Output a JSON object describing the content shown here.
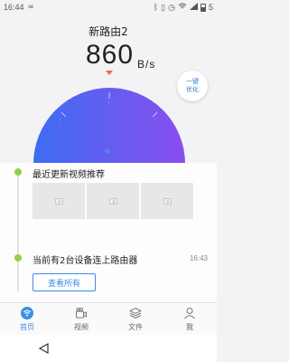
{
  "status_bar": {
    "time": "16:44",
    "battery_level": "5"
  },
  "header": {
    "title": "新路由2",
    "speed_value": "860",
    "speed_unit": "B/s"
  },
  "optimize_button": {
    "line1": "一键",
    "line2": "优化"
  },
  "gauge": {
    "gradient_start": "#3d6df2",
    "gradient_end": "#8a4ef0"
  },
  "feed": {
    "video_section_title": "最近更新视频推荐",
    "device_section_title": "当前有2台设备连上路由器",
    "device_section_time": "16:43",
    "view_all_label": "查看所有"
  },
  "tabs": [
    {
      "label": "首页",
      "icon": "wifi-icon",
      "active": true
    },
    {
      "label": "视频",
      "icon": "video-camera-icon",
      "active": false
    },
    {
      "label": "文件",
      "icon": "layers-icon",
      "active": false
    },
    {
      "label": "我",
      "icon": "person-icon",
      "active": false
    }
  ],
  "colors": {
    "accent": "#3a8ee6",
    "timeline_dot": "#8fd14f",
    "pointer": "#ee6b3a"
  }
}
